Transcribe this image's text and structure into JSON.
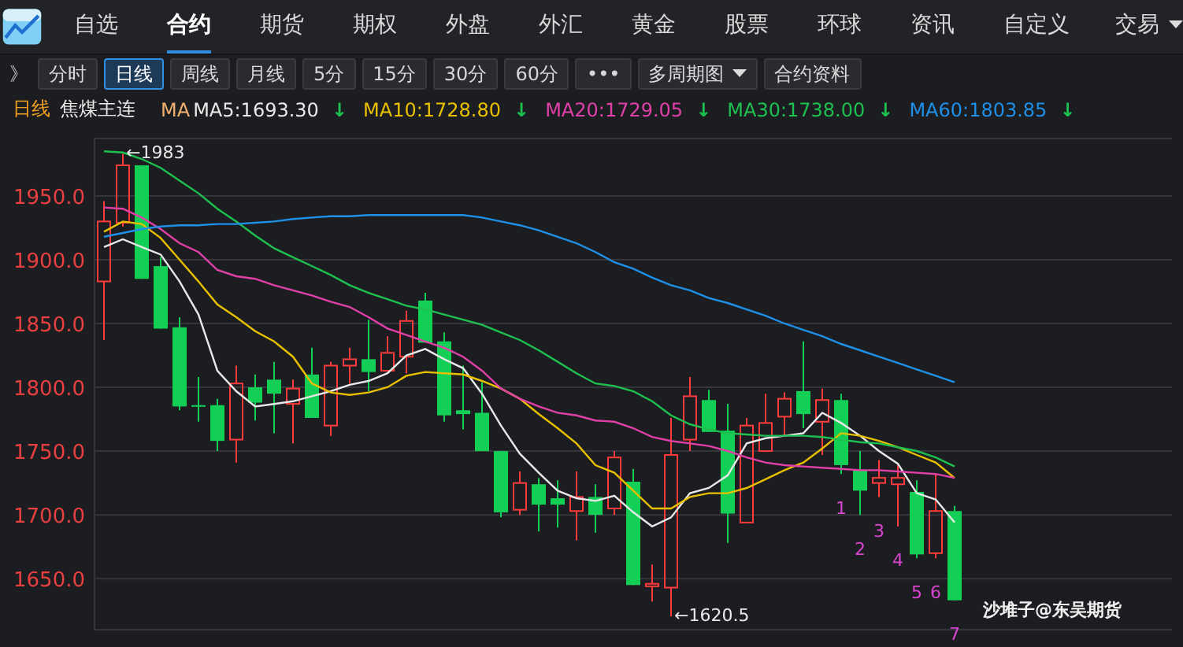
{
  "nav": {
    "items": [
      {
        "label": "自选",
        "selected": false
      },
      {
        "label": "合约",
        "selected": true
      },
      {
        "label": "期货",
        "selected": false
      },
      {
        "label": "期权",
        "selected": false
      },
      {
        "label": "外盘",
        "selected": false
      },
      {
        "label": "外汇",
        "selected": false
      },
      {
        "label": "黄金",
        "selected": false
      },
      {
        "label": "股票",
        "selected": false
      },
      {
        "label": "环球",
        "selected": false
      },
      {
        "label": "资讯",
        "selected": false
      },
      {
        "label": "自定义",
        "selected": false
      },
      {
        "label": "交易",
        "selected": false,
        "kind": "dropdown"
      }
    ]
  },
  "toolbar": {
    "expander": "》",
    "buttons": [
      {
        "label": "分时",
        "selected": false,
        "kind": "plain"
      },
      {
        "label": "日线",
        "selected": true,
        "kind": "plain"
      },
      {
        "label": "周线",
        "selected": false,
        "kind": "plain"
      },
      {
        "label": "月线",
        "selected": false,
        "kind": "plain"
      },
      {
        "label": "5分",
        "selected": false,
        "kind": "plain"
      },
      {
        "label": "15分",
        "selected": false,
        "kind": "plain"
      },
      {
        "label": "30分",
        "selected": false,
        "kind": "plain"
      },
      {
        "label": "60分",
        "selected": false,
        "kind": "plain"
      },
      {
        "label": "•••",
        "selected": false,
        "kind": "plain"
      },
      {
        "label": "多周期图",
        "selected": false,
        "kind": "dropdown"
      },
      {
        "label": "合约资料",
        "selected": false,
        "kind": "plain"
      }
    ]
  },
  "legend": {
    "period": "日线",
    "instrument": "焦煤主连",
    "ma_label": "MA",
    "items": [
      {
        "label": "MA5:1693.30",
        "color": "#e8e8e8",
        "arrow": "↓"
      },
      {
        "label": "MA10:1728.80",
        "color": "#e8c000",
        "arrow": "↓"
      },
      {
        "label": "MA20:1729.05",
        "color": "#e040a8",
        "arrow": "↓"
      },
      {
        "label": "MA30:1738.00",
        "color": "#1ec050",
        "arrow": "↓"
      },
      {
        "label": "MA60:1803.85",
        "color": "#1e90e8",
        "arrow": "↓"
      }
    ]
  },
  "chart": {
    "signature": "沙堆子@东吴期货",
    "counts": [
      {
        "text": "1"
      },
      {
        "text": "2"
      },
      {
        "text": "3"
      },
      {
        "text": "4"
      },
      {
        "text": "5"
      },
      {
        "text": "6"
      },
      {
        "text": "7"
      }
    ],
    "chart_data": {
      "type": "candlestick",
      "grid": true,
      "ylim": [
        1610,
        1995
      ],
      "categories": [
        null,
        null,
        null,
        null,
        null,
        null,
        null,
        null,
        null,
        null,
        null,
        null,
        null,
        null,
        null,
        null,
        null,
        null,
        null,
        null,
        null,
        null,
        null,
        null,
        null,
        null,
        null,
        null,
        null,
        null,
        null,
        null,
        null,
        null,
        null,
        null,
        null,
        null,
        null,
        null,
        null,
        null,
        null,
        null,
        null,
        null,
        null,
        null,
        null,
        null,
        null,
        null,
        null,
        null,
        null,
        null,
        null
      ],
      "yticks": [
        {
          "value": 1650,
          "label": "1650.0"
        },
        {
          "value": 1700,
          "label": "1700.0"
        },
        {
          "value": 1750,
          "label": "1750.0"
        },
        {
          "value": 1800,
          "label": "1800.0"
        },
        {
          "value": 1850,
          "label": "1850.0"
        },
        {
          "value": 1900,
          "label": "1900.0"
        },
        {
          "value": 1950,
          "label": "1950.0"
        }
      ],
      "ohlc": [
        [
          1883,
          1946,
          1837,
          1930
        ],
        [
          1929,
          1983,
          1926,
          1974
        ],
        [
          1974,
          1974,
          1885,
          1885
        ],
        [
          1895,
          1902,
          1846,
          1846
        ],
        [
          1847,
          1855,
          1782,
          1785
        ],
        [
          1786,
          1808,
          1773,
          1785
        ],
        [
          1786,
          1791,
          1750,
          1758
        ],
        [
          1759,
          1817,
          1741,
          1803
        ],
        [
          1800,
          1810,
          1774,
          1788
        ],
        [
          1806,
          1820,
          1764,
          1795
        ],
        [
          1787,
          1806,
          1756,
          1799
        ],
        [
          1810,
          1831,
          1776,
          1776
        ],
        [
          1770,
          1820,
          1762,
          1817
        ],
        [
          1817,
          1831,
          1803,
          1822
        ],
        [
          1822,
          1853,
          1797,
          1812
        ],
        [
          1813,
          1840,
          1813,
          1827
        ],
        [
          1824,
          1860,
          1811,
          1852
        ],
        [
          1868,
          1874,
          1835,
          1835
        ],
        [
          1836,
          1843,
          1773,
          1778
        ],
        [
          1782,
          1817,
          1767,
          1779
        ],
        [
          1780,
          1804,
          1750,
          1750
        ],
        [
          1750,
          1750,
          1698,
          1702
        ],
        [
          1704,
          1734,
          1700,
          1725
        ],
        [
          1724,
          1729,
          1687,
          1708
        ],
        [
          1713,
          1727,
          1690,
          1708
        ],
        [
          1703,
          1734,
          1680,
          1714
        ],
        [
          1714,
          1724,
          1686,
          1700
        ],
        [
          1705,
          1750,
          1700,
          1745
        ],
        [
          1726,
          1736,
          1645,
          1645
        ],
        [
          1644,
          1661,
          1632,
          1646
        ],
        [
          1643,
          1776,
          1620.5,
          1747
        ],
        [
          1759,
          1808,
          1750,
          1793
        ],
        [
          1790,
          1798,
          1765,
          1765
        ],
        [
          1766,
          1787,
          1678,
          1701
        ],
        [
          1694,
          1776,
          1694,
          1770
        ],
        [
          1750,
          1795,
          1750,
          1772
        ],
        [
          1777,
          1796,
          1762,
          1791
        ],
        [
          1797,
          1836,
          1768,
          1779
        ],
        [
          1773,
          1799,
          1747,
          1790
        ],
        [
          1790,
          1795,
          1732,
          1739
        ],
        [
          1735,
          1750,
          1700,
          1719
        ],
        [
          1725,
          1743,
          1714,
          1729
        ],
        [
          1724,
          1739,
          1691,
          1729
        ],
        [
          1718,
          1727,
          1666,
          1669
        ],
        [
          1670,
          1732,
          1666,
          1703
        ],
        [
          1703,
          1707,
          1633,
          1633
        ],
        null,
        null,
        null,
        null,
        null,
        null,
        null,
        null,
        null,
        null,
        null
      ],
      "series": [
        {
          "type": "line",
          "color": "#e8e8e8",
          "values": [
            1910,
            1916,
            1910,
            1904,
            1883,
            1857,
            1813,
            1797,
            1785,
            1787,
            1789,
            1793,
            1797,
            1802,
            1805,
            1811,
            1825,
            1830,
            1822,
            1815,
            1795,
            1770,
            1748,
            1733,
            1719,
            1713,
            1711,
            1715,
            1702,
            1691,
            1698,
            1717,
            1721,
            1731,
            1756,
            1760,
            1762,
            1764,
            1780,
            1772,
            1762,
            1750,
            1740,
            1717,
            1712,
            1694,
            null,
            null,
            null,
            null,
            null,
            null,
            null,
            null,
            null,
            null,
            null
          ]
        },
        {
          "type": "line",
          "color": "#e8c000",
          "values": [
            1922,
            1930,
            1928,
            1917,
            1900,
            1883,
            1865,
            1855,
            1844,
            1836,
            1824,
            1803,
            1796,
            1794,
            1796,
            1800,
            1809,
            1812,
            1811,
            1810,
            1805,
            1799,
            1791,
            1779,
            1768,
            1756,
            1739,
            1733,
            1719,
            1705,
            1705,
            1714,
            1717,
            1717,
            1721,
            1728,
            1735,
            1741,
            1752,
            1764,
            1762,
            1758,
            1753,
            1747,
            1741,
            1729,
            null,
            null,
            null,
            null,
            null,
            null,
            null,
            null,
            null,
            null,
            null
          ]
        },
        {
          "type": "line",
          "color": "#e040a8",
          "values": [
            1941,
            1940,
            1933,
            1924,
            1913,
            1906,
            1892,
            1887,
            1885,
            1880,
            1876,
            1872,
            1867,
            1863,
            1855,
            1846,
            1841,
            1836,
            1831,
            1824,
            1813,
            1799,
            1791,
            1785,
            1780,
            1778,
            1774,
            1773,
            1768,
            1761,
            1758,
            1756,
            1754,
            1750,
            1745,
            1741,
            1739,
            1738,
            1737,
            1736,
            1735,
            1735,
            1734,
            1733,
            1732,
            1729,
            null,
            null,
            null,
            null,
            null,
            null,
            null,
            null,
            null,
            null,
            null
          ]
        },
        {
          "type": "line",
          "color": "#1ec050",
          "values": [
            1985,
            1984,
            1979,
            1972,
            1962,
            1952,
            1940,
            1930,
            1919,
            1909,
            1902,
            1895,
            1888,
            1880,
            1874,
            1869,
            1864,
            1861,
            1857,
            1853,
            1849,
            1843,
            1837,
            1829,
            1820,
            1811,
            1803,
            1801,
            1797,
            1789,
            1778,
            1771,
            1767,
            1764,
            1763,
            1762,
            1762,
            1762,
            1761,
            1759,
            1757,
            1756,
            1753,
            1750,
            1745,
            1738,
            null,
            null,
            null,
            null,
            null,
            null,
            null,
            null,
            null,
            null,
            null
          ]
        },
        {
          "type": "line",
          "color": "#1e90e8",
          "values": [
            1918,
            1921,
            1924,
            1926,
            1927,
            1927,
            1928,
            1928,
            1929,
            1930,
            1932,
            1933,
            1934,
            1934,
            1935,
            1935,
            1935,
            1935,
            1935,
            1935,
            1933,
            1930,
            1927,
            1923,
            1918,
            1913,
            1906,
            1898,
            1893,
            1886,
            1880,
            1876,
            1870,
            1866,
            1861,
            1856,
            1850,
            1845,
            1840,
            1834,
            1829,
            1824,
            1819,
            1814,
            1809,
            1804,
            null,
            null,
            null,
            null,
            null,
            null,
            null,
            null,
            null,
            null,
            null
          ]
        }
      ],
      "annotations": [
        "←1983",
        "←1620.5"
      ]
    }
  }
}
